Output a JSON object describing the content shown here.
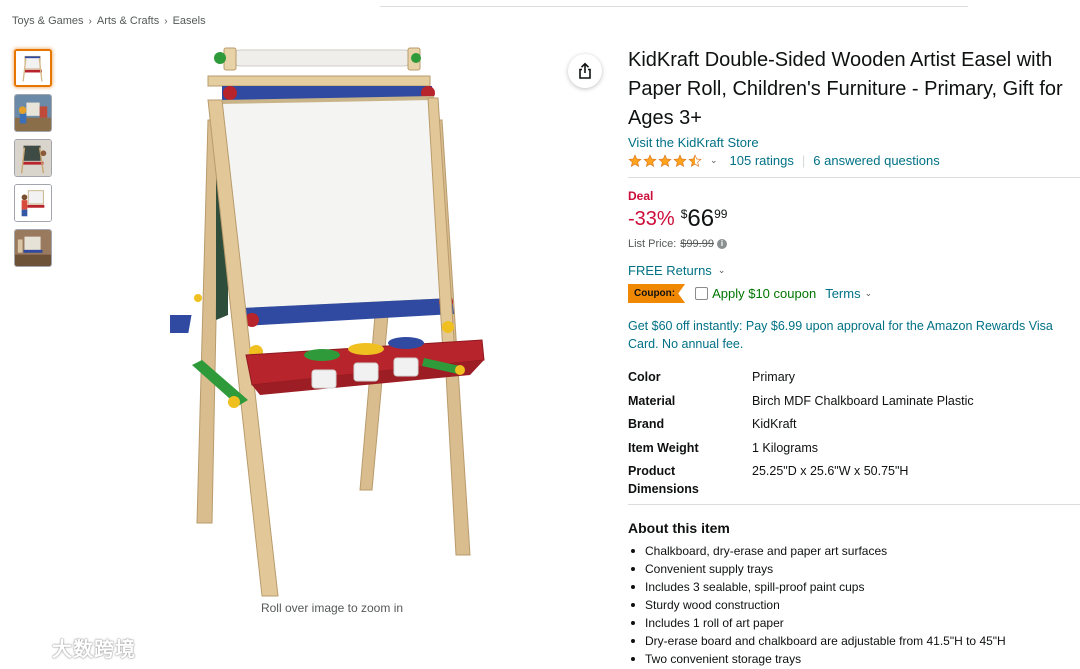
{
  "breadcrumb": [
    "Toys & Games",
    "Arts & Crafts",
    "Easels"
  ],
  "breadcrumb_separator": "›",
  "gallery": {
    "thumbnails": [
      {
        "name": "easel-front-thumbnail",
        "active": true
      },
      {
        "name": "easel-lifestyle-thumbnail",
        "active": false
      },
      {
        "name": "easel-chalkboard-thumbnail",
        "active": false
      },
      {
        "name": "easel-child-thumbnail",
        "active": false
      },
      {
        "name": "easel-room-thumbnail",
        "active": false
      }
    ],
    "zoom_hint": "Roll over image to zoom in",
    "share_icon": "share-icon"
  },
  "product": {
    "title": "KidKraft Double-Sided Wooden Artist Easel with Paper Roll, Children's Furniture - Primary, Gift for Ages 3+",
    "store_link": "Visit the KidKraft Store",
    "rating": 4.5,
    "ratings_count": "105 ratings",
    "answered_questions": "6 answered questions",
    "deal_label": "Deal",
    "discount": "-33%",
    "price_currency": "$",
    "price_whole": "66",
    "price_fraction": "99",
    "list_price_label": "List Price:",
    "list_price": "$99.99",
    "returns": "FREE Returns",
    "coupon_badge": "Coupon:",
    "coupon_text": "Apply $10 coupon",
    "terms": "Terms",
    "promo": "Get $60 off instantly: Pay $6.99 upon approval for the Amazon Rewards Visa Card. No annual fee."
  },
  "specs": [
    {
      "label": "Color",
      "value": "Primary"
    },
    {
      "label": "Material",
      "value": "Birch MDF Chalkboard Laminate Plastic"
    },
    {
      "label": "Brand",
      "value": "KidKraft"
    },
    {
      "label": "Item Weight",
      "value": "1 Kilograms"
    },
    {
      "label": "Product Dimensions",
      "value": "25.25\"D x 25.6\"W x 50.75\"H"
    }
  ],
  "about": {
    "heading": "About this item",
    "bullets": [
      "Chalkboard, dry-erase and paper art surfaces",
      "Convenient supply trays",
      "Includes 3 sealable, spill-proof paint cups",
      "Sturdy wood construction",
      "Includes 1 roll of art paper",
      "Dry-erase board and chalkboard are adjustable from 41.5\"H to 45\"H",
      "Two convenient storage trays"
    ]
  },
  "watermark": "大数跨境",
  "colors": {
    "link": "#007185",
    "deal": "#cc0c39",
    "coupon_badge": "#f08804",
    "coupon_text": "#007600",
    "star": "#ffa41c",
    "active_thumb_border": "#e77600"
  }
}
